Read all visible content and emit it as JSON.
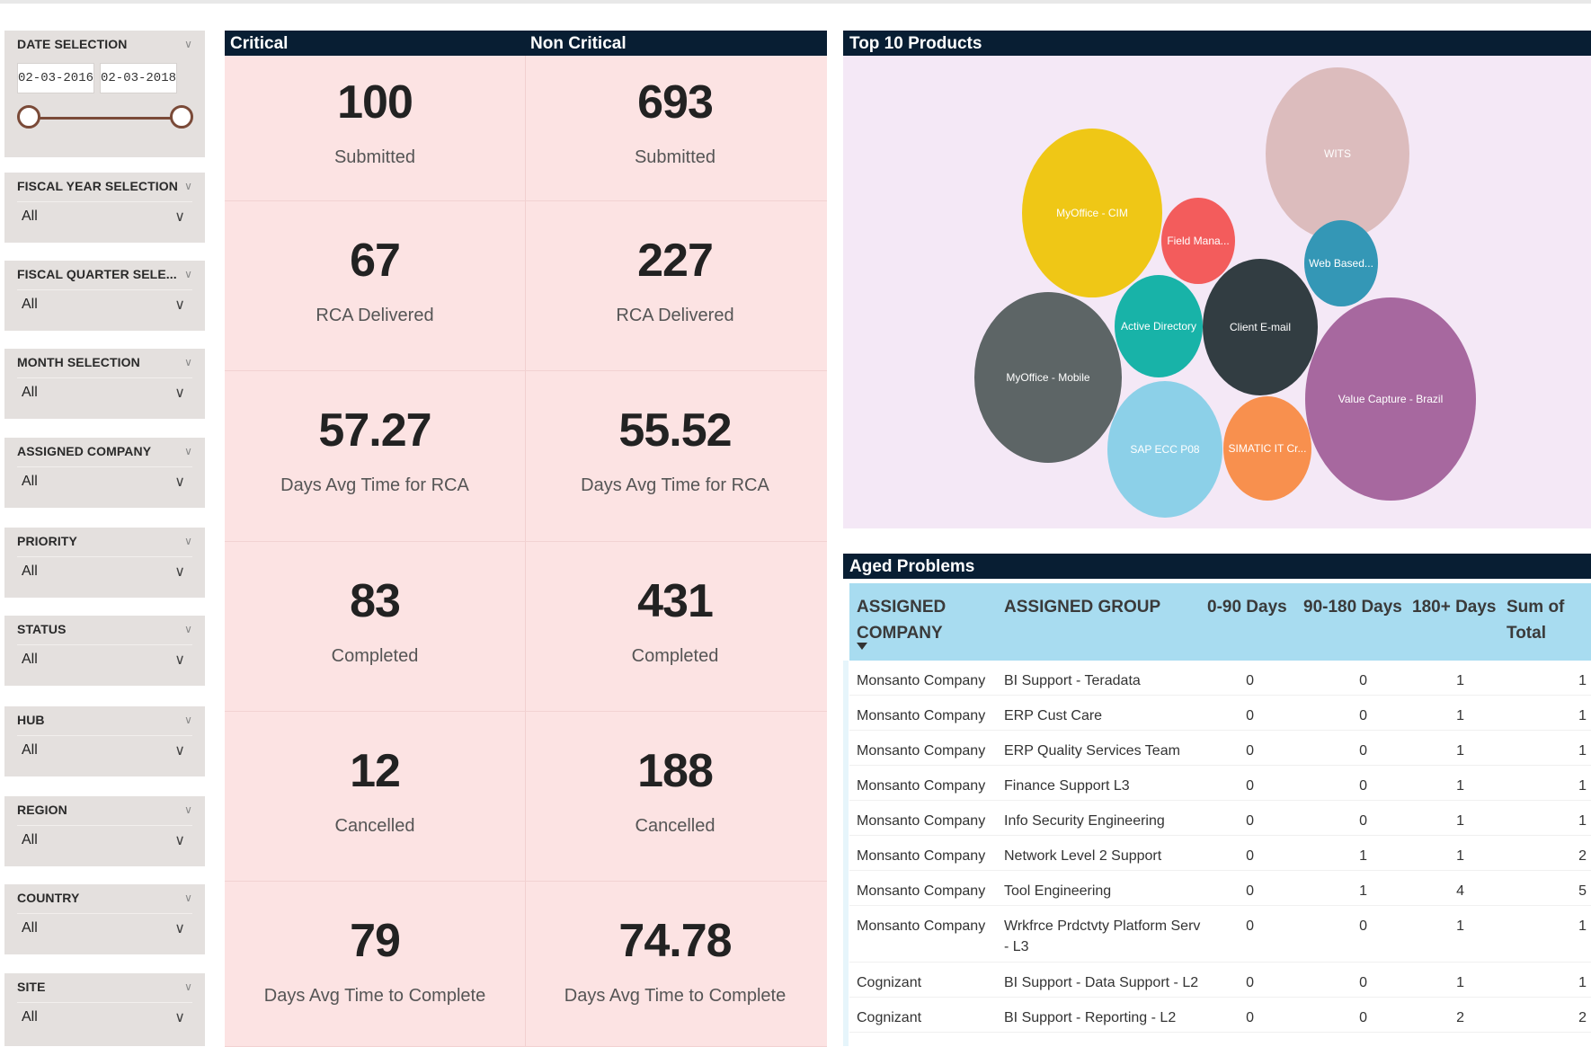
{
  "slicers": {
    "date": {
      "title": "DATE SELECTION",
      "start": "02-03-2016",
      "end": "02-03-2018"
    },
    "items": [
      {
        "title": "FISCAL YEAR SELECTION",
        "value": "All"
      },
      {
        "title": "FISCAL QUARTER SELE...",
        "value": "All"
      },
      {
        "title": "MONTH SELECTION",
        "value": "All"
      },
      {
        "title": "ASSIGNED COMPANY",
        "value": "All"
      },
      {
        "title": "PRIORITY",
        "value": "All"
      },
      {
        "title": "STATUS",
        "value": "All"
      },
      {
        "title": "HUB",
        "value": "All"
      },
      {
        "title": "REGION",
        "value": "All"
      },
      {
        "title": "COUNTRY",
        "value": "All"
      },
      {
        "title": "SITE",
        "value": "All"
      }
    ]
  },
  "kpi": {
    "critical_title": "Critical",
    "noncritical_title": "Non Critical",
    "rows": [
      {
        "label": "Submitted",
        "critical": "100",
        "noncritical": "693"
      },
      {
        "label": "RCA Delivered",
        "critical": "67",
        "noncritical": "227"
      },
      {
        "label": "Days Avg Time for RCA",
        "critical": "57.27",
        "noncritical": "55.52"
      },
      {
        "label": "Completed",
        "critical": "83",
        "noncritical": "431"
      },
      {
        "label": "Cancelled",
        "critical": "12",
        "noncritical": "188"
      },
      {
        "label": "Days Avg Time to Complete",
        "critical": "79",
        "noncritical": "74.78"
      }
    ]
  },
  "products": {
    "title": "Top 10 Products",
    "bubbles": [
      {
        "label": "WITS",
        "color": "#dcbcbd"
      },
      {
        "label": "MyOffice - CIM",
        "color": "#efc716"
      },
      {
        "label": "Field Mana...",
        "color": "#f35c5c"
      },
      {
        "label": "Web Based...",
        "color": "#3497b6"
      },
      {
        "label": "Active Directory",
        "color": "#18b3a8"
      },
      {
        "label": "Client E-mail",
        "color": "#323d42"
      },
      {
        "label": "MyOffice - Mobile",
        "color": "#5d6566"
      },
      {
        "label": "Value Capture - Brazil",
        "color": "#a7689f"
      },
      {
        "label": "SAP ECC P08",
        "color": "#8cd0e8"
      },
      {
        "label": "SIMATIC IT Cr...",
        "color": "#f8904e"
      }
    ]
  },
  "aged": {
    "title": "Aged Problems",
    "columns": {
      "company": "ASSIGNED COMPANY",
      "group": "ASSIGNED GROUP",
      "d0_90": "0-90 Days",
      "d90_180": "90-180 Days",
      "d180": "180+ Days",
      "total": "Sum of Total"
    },
    "rows": [
      {
        "company": "Monsanto Company",
        "group": "BI Support - Teradata",
        "d0_90": "0",
        "d90_180": "0",
        "d180": "1",
        "total": "1"
      },
      {
        "company": "Monsanto Company",
        "group": "ERP Cust Care",
        "d0_90": "0",
        "d90_180": "0",
        "d180": "1",
        "total": "1"
      },
      {
        "company": "Monsanto Company",
        "group": "ERP Quality Services Team",
        "d0_90": "0",
        "d90_180": "0",
        "d180": "1",
        "total": "1"
      },
      {
        "company": "Monsanto Company",
        "group": "Finance Support L3",
        "d0_90": "0",
        "d90_180": "0",
        "d180": "1",
        "total": "1"
      },
      {
        "company": "Monsanto Company",
        "group": "Info Security Engineering",
        "d0_90": "0",
        "d90_180": "0",
        "d180": "1",
        "total": "1"
      },
      {
        "company": "Monsanto Company",
        "group": "Network Level 2 Support",
        "d0_90": "0",
        "d90_180": "1",
        "d180": "1",
        "total": "2"
      },
      {
        "company": "Monsanto Company",
        "group": "Tool Engineering",
        "d0_90": "0",
        "d90_180": "1",
        "d180": "4",
        "total": "5"
      },
      {
        "company": "Monsanto Company",
        "group": "Wrkfrce Prdctvty Platform Serv - L3",
        "d0_90": "0",
        "d90_180": "0",
        "d180": "1",
        "total": "1"
      },
      {
        "company": "Cognizant",
        "group": "BI Support - Data Support - L2",
        "d0_90": "0",
        "d90_180": "0",
        "d180": "1",
        "total": "1"
      },
      {
        "company": "Cognizant",
        "group": "BI Support - Reporting - L2",
        "d0_90": "0",
        "d90_180": "0",
        "d180": "2",
        "total": "2"
      }
    ]
  }
}
